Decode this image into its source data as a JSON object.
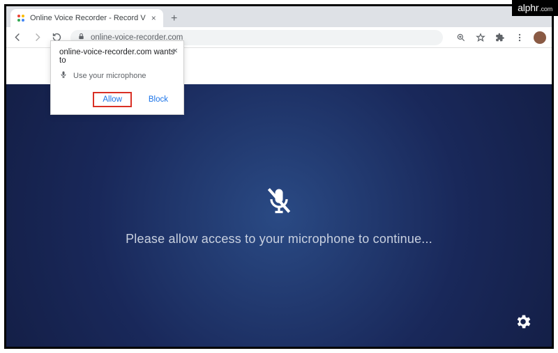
{
  "watermark": {
    "brand": "alphr",
    "suffix": ".com"
  },
  "tab": {
    "title": "Online Voice Recorder - Record V",
    "close_glyph": "×"
  },
  "toolbar": {
    "url": "online-voice-recorder.com",
    "newtab_glyph": "+"
  },
  "permission": {
    "title": "online-voice-recorder.com wants to",
    "request": "Use your microphone",
    "allow": "Allow",
    "block": "Block",
    "close_glyph": "×"
  },
  "page": {
    "message": "Please allow access to your microphone to continue..."
  }
}
